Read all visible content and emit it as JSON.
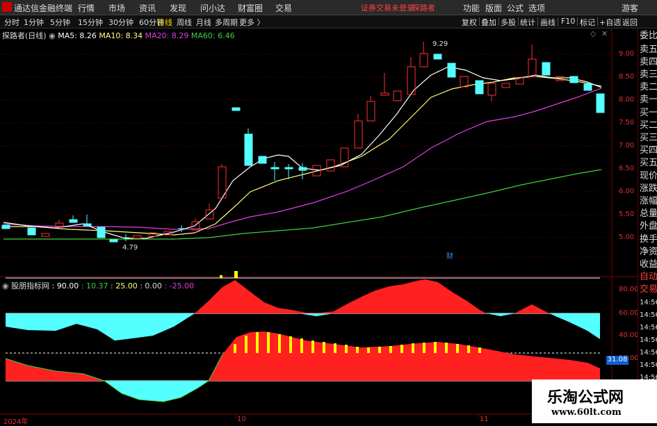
{
  "app": {
    "title": "通达信金融终端"
  },
  "menu": [
    "行情",
    "市场",
    "资讯",
    "发现",
    "问小达",
    "财富圈",
    "交易"
  ],
  "status": {
    "login": "证券交易未登录",
    "user": "探路者"
  },
  "right_menu": [
    "功能",
    "版面",
    "公式",
    "选项",
    "游客"
  ],
  "periods": [
    "分时",
    "1分钟",
    "5分钟",
    "15分钟",
    "30分钟",
    "60分钟",
    "日线",
    "周线",
    "月线",
    "多周期",
    "更多 〉"
  ],
  "active_period": "日线",
  "right_tabs": [
    "复权",
    "叠加",
    "多股",
    "统计",
    "画线",
    "F10",
    "标记",
    "+自选",
    "返回"
  ],
  "legend": {
    "stock": "探路者(日线)",
    "ma5": "MA5: 8.26",
    "ma10": "MA10: 8.34",
    "ma20": "MA20: 8.29",
    "ma60": "MA60: 6.46"
  },
  "price_axis": [
    "9.00",
    "8.50",
    "8.00",
    "7.50",
    "7.00",
    "6.50",
    "6.00",
    "5.50",
    "5.00"
  ],
  "annotations": {
    "high": "9.29",
    "low": "4.79",
    "cai": "财"
  },
  "indicator": {
    "name": "股朋指标网",
    "v1": ": 90.00",
    "v2": ": 10.37",
    "v3": ": 25.00",
    "v4": ": 0.00",
    "v5": ": -25.00",
    "current": "31.08"
  },
  "indicator_axis": [
    "80.00",
    "60.00",
    "40.00",
    "20.00"
  ],
  "sidebar": [
    "委比",
    "卖五",
    "卖四",
    "卖三",
    "卖二",
    "卖一",
    "买一",
    "买二",
    "买三",
    "买四",
    "买五",
    "现价",
    "涨跌",
    "涨幅",
    "总量",
    "外盘",
    "换手",
    "净资",
    "收益",
    "自动",
    "交易",
    "14:56",
    "14:56",
    "14:56",
    "14:56",
    "14:56",
    "14:56",
    "14:56"
  ],
  "dates": [
    "2024年",
    "10",
    "11"
  ],
  "watermark": {
    "title": "乐淘公式网",
    "url": "www.60lt.com"
  },
  "colors": {
    "up": "#ff3030",
    "down": "#54ffff",
    "ma5": "#ffffff",
    "ma10": "#ffff80",
    "ma20": "#e040e0",
    "ma60": "#40d040"
  }
}
